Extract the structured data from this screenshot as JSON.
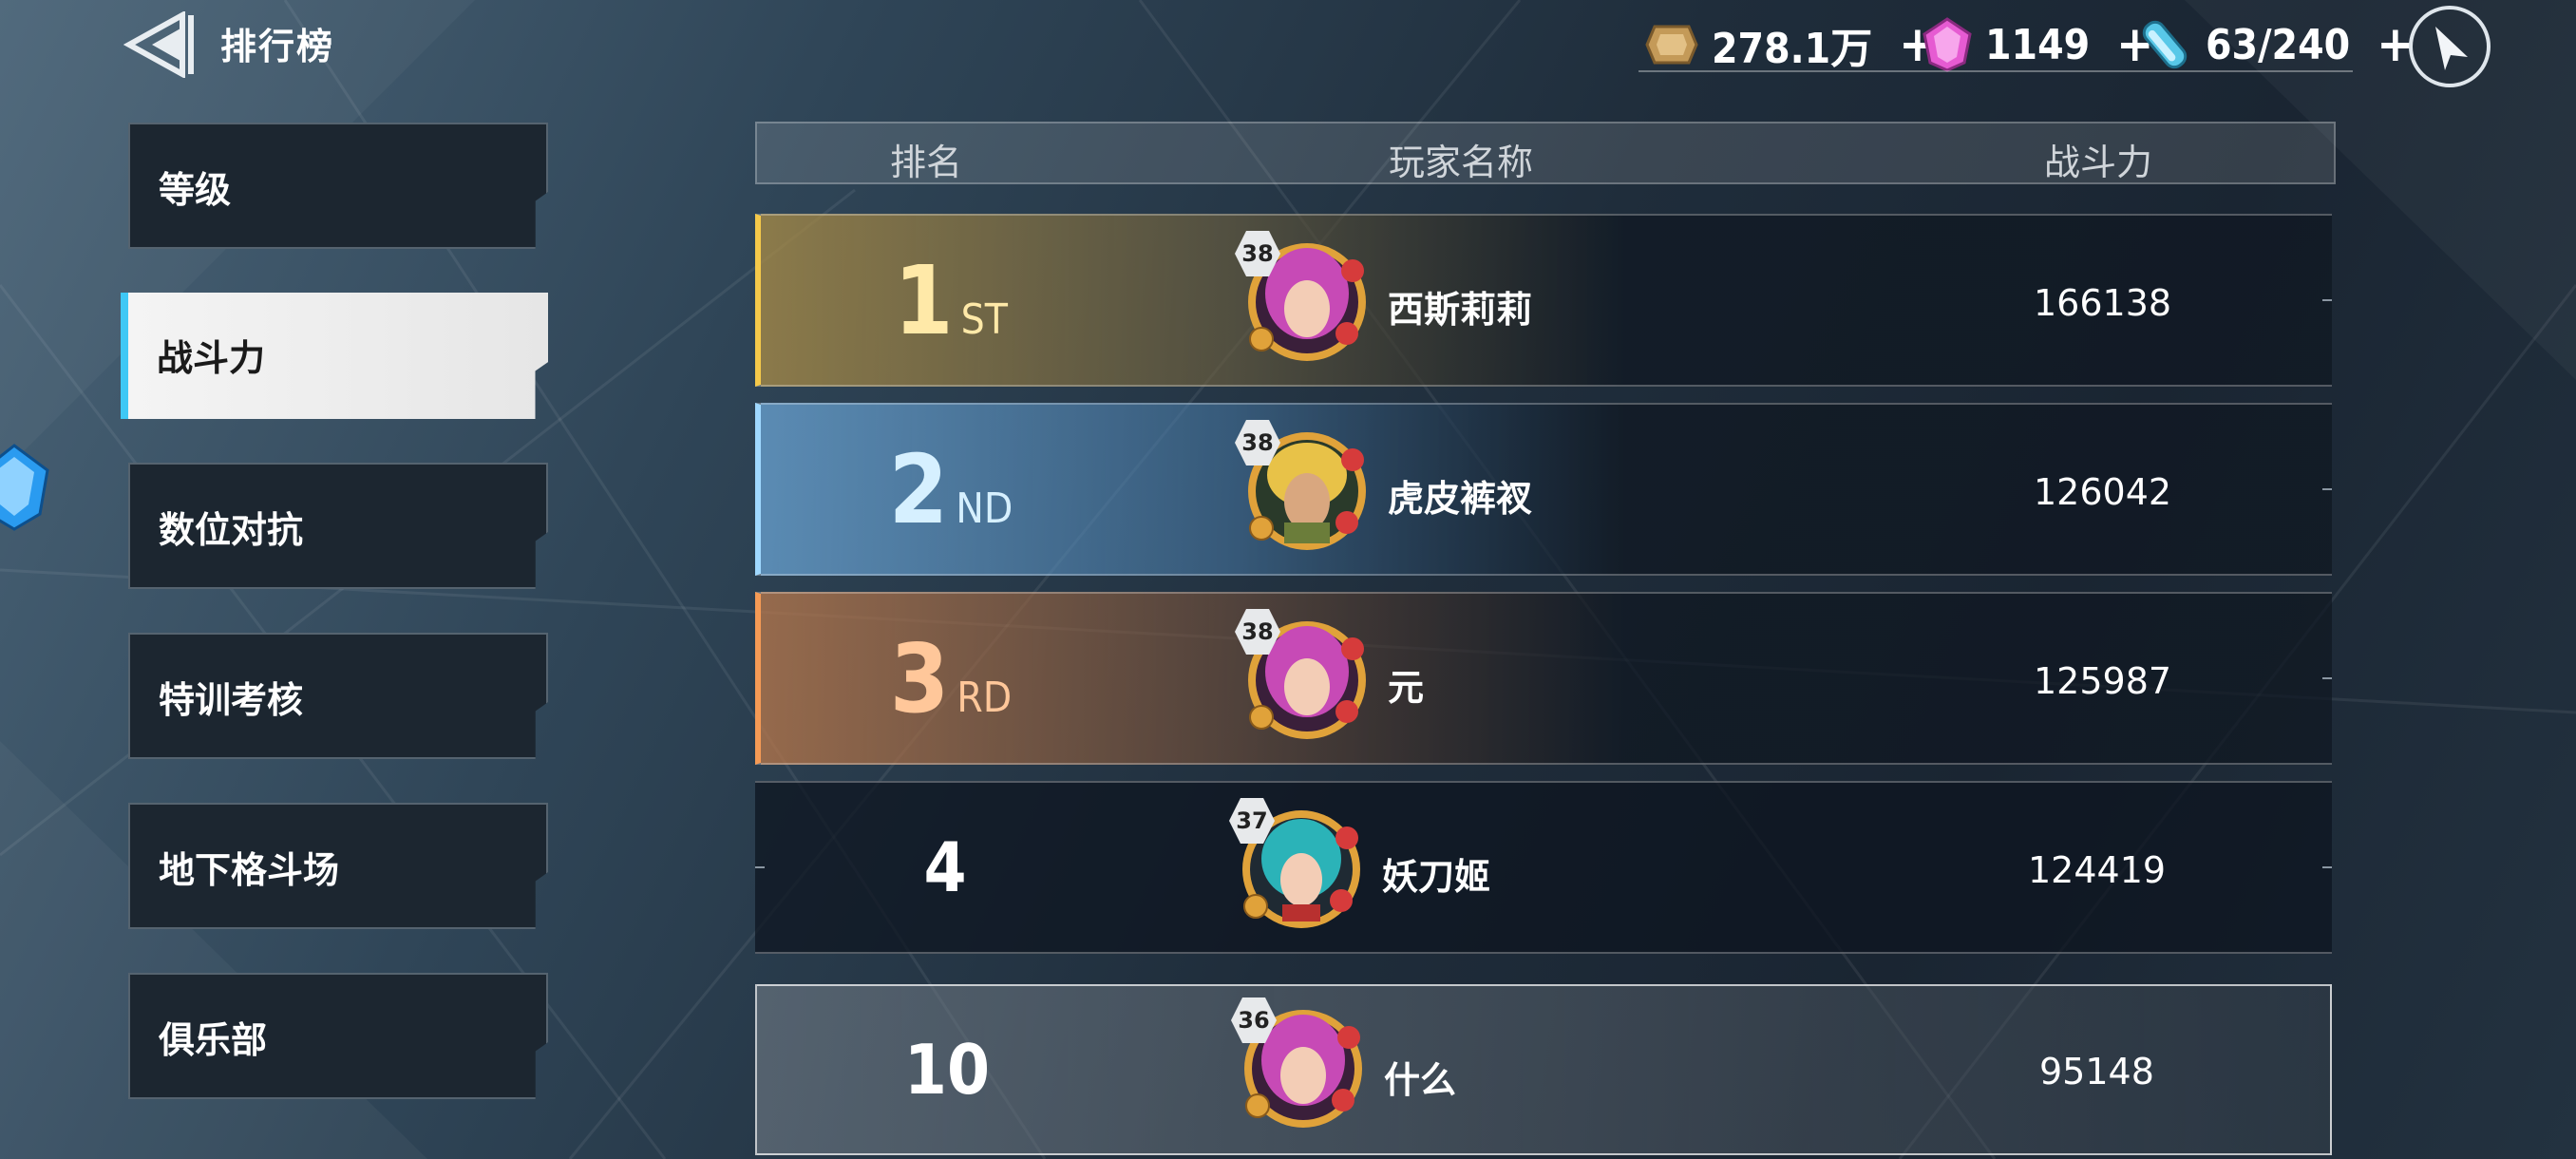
{
  "header": {
    "title": "排行榜"
  },
  "currencies": [
    {
      "name": "gold-coin-icon",
      "value": "278.1万",
      "plus": "+"
    },
    {
      "name": "pink-gem-icon",
      "value": "1149",
      "plus": "+"
    },
    {
      "name": "energy-capsule-icon",
      "value": "63/240",
      "plus": "+"
    }
  ],
  "sidebar": {
    "tabs": [
      {
        "label": "等级"
      },
      {
        "label": "战斗力",
        "active": true
      },
      {
        "label": "数位对抗"
      },
      {
        "label": "特训考核"
      },
      {
        "label": "地下格斗场"
      },
      {
        "label": "俱乐部"
      }
    ]
  },
  "table": {
    "headers": {
      "rank": "排名",
      "player": "玩家名称",
      "power": "战斗力"
    },
    "rows": [
      {
        "rank": "1",
        "suffix": "ST",
        "level": "38",
        "name": "西斯莉莉",
        "power": "166138",
        "avatar": "pink-hair-avatar"
      },
      {
        "rank": "2",
        "suffix": "ND",
        "level": "38",
        "name": "虎皮裤衩",
        "power": "126042",
        "avatar": "blonde-hair-avatar"
      },
      {
        "rank": "3",
        "suffix": "RD",
        "level": "38",
        "name": "元",
        "power": "125987",
        "avatar": "pink-hair-avatar"
      },
      {
        "rank": "4",
        "suffix": "",
        "level": "37",
        "name": "妖刀姬",
        "power": "124419",
        "avatar": "teal-hair-avatar"
      }
    ],
    "self": {
      "rank": "10",
      "level": "36",
      "name": "什么",
      "power": "95148",
      "avatar": "pink-hair-avatar"
    }
  },
  "colors": {
    "gold": "#f5c94a",
    "silver": "#9fd8ff",
    "bronze": "#f59a55",
    "active_tab_accent": "#3fc8f5"
  }
}
